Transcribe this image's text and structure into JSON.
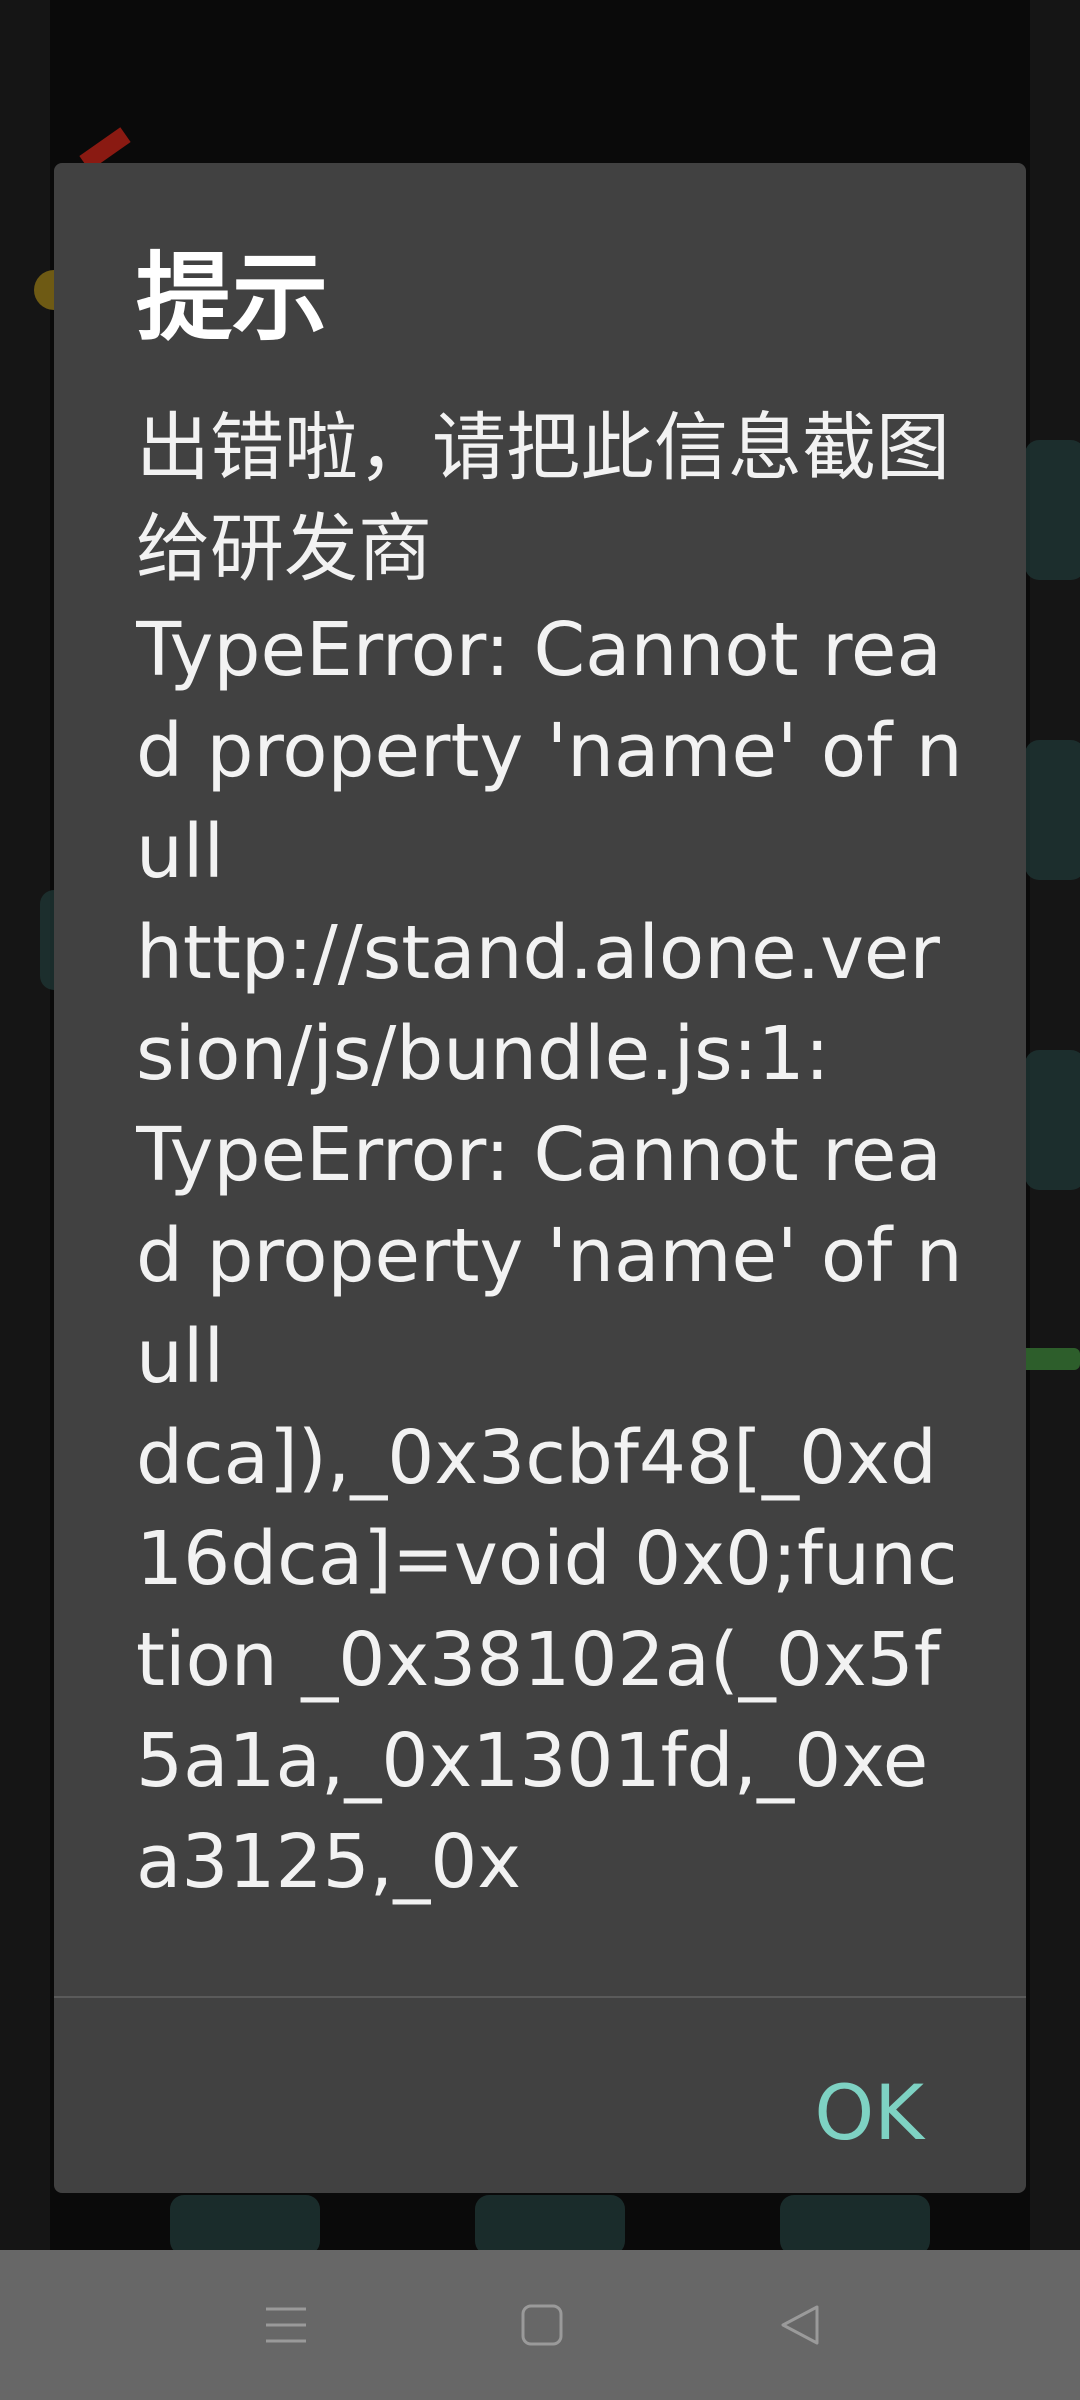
{
  "dialog": {
    "title": "提示",
    "message": "出错啦，请把此信息截图给研发商\nTypeError: Cannot read property 'name' of null\nhttp://stand.alone.version/js/bundle.js:1:\nTypeError: Cannot read property 'name' of null\ndca]),_0x3cbf48[_0xd16dca]=void 0x0;function _0x38102a(_0x5f5a1a,_0x1301fd,_0xea3125,_0x",
    "ok_label": "OK"
  },
  "navbar": {
    "menu_icon": "menu-lines-icon",
    "home_icon": "square-home-icon",
    "back_icon": "triangle-back-icon"
  },
  "colors": {
    "dialog_bg": "#414141",
    "accent": "#7ed2c3",
    "navbar_bg": "#676767"
  }
}
